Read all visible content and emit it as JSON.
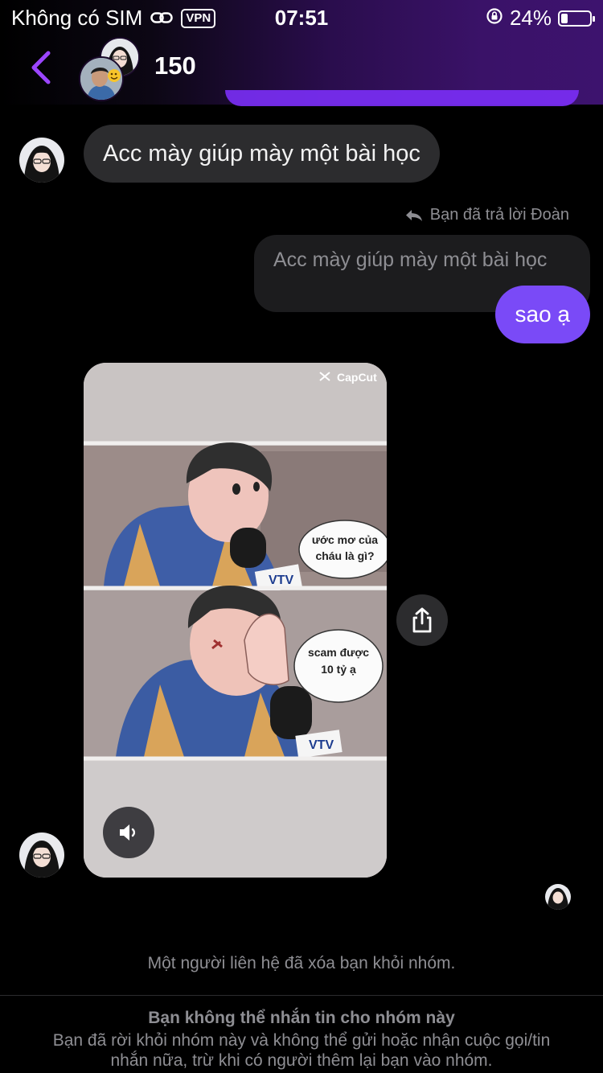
{
  "status_bar": {
    "carrier": "Không có SIM",
    "vpn": "VPN",
    "time": "07:51",
    "battery_percent": "24%",
    "battery_level": 0.24
  },
  "header": {
    "title": "150",
    "back_icon": "chevron-left-icon",
    "accent_color": "#7b2ff7"
  },
  "messages": {
    "incoming_text": "Acc mày giúp mày một bài học",
    "reply_note": "Bạn đã trả lời Đoàn",
    "quoted_text": "Acc mày giúp mày một bài học",
    "outgoing_text": "sao ạ",
    "outgoing_color": "#7a4af7"
  },
  "video": {
    "watermark": "CapCut",
    "speech_1": [
      "ước mơ của",
      "cháu là gì?"
    ],
    "speech_2": [
      "scam được",
      "10 tỷ ạ"
    ],
    "mic_label_1": "VTV",
    "mic_label_2": "VTV",
    "mute_icon": "speaker-icon",
    "share_icon": "share-icon"
  },
  "system_message": "Một người liên hệ đã xóa bạn khỏi nhóm.",
  "footer": {
    "title": "Bạn không thể nhắn tin cho nhóm này",
    "body": "Bạn đã rời khỏi nhóm này và không thể gửi hoặc nhận cuộc gọi/tin nhắn nữa, trừ khi có người thêm lại bạn vào nhóm."
  }
}
